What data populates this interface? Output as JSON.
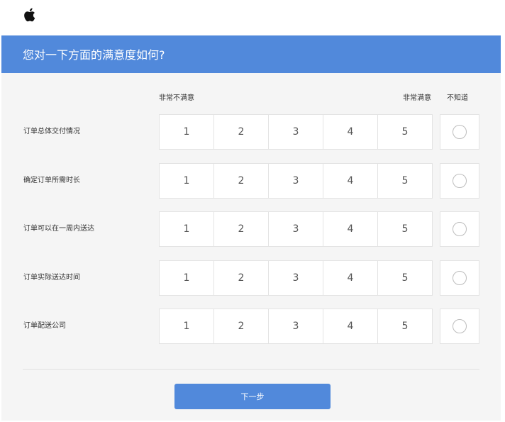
{
  "header": {
    "logo_icon": "apple-logo-icon",
    "question": "您对一下方面的满意度如何?"
  },
  "scale_labels": {
    "low": "非常不满意",
    "high": "非常满意",
    "dont_know": "不知道"
  },
  "rows": [
    {
      "label": "订单总体交付情况",
      "options": [
        "1",
        "2",
        "3",
        "4",
        "5"
      ]
    },
    {
      "label": "确定订单所需时长",
      "options": [
        "1",
        "2",
        "3",
        "4",
        "5"
      ]
    },
    {
      "label": "订单可以在一周内送达",
      "options": [
        "1",
        "2",
        "3",
        "4",
        "5"
      ]
    },
    {
      "label": "订单实际送达时间",
      "options": [
        "1",
        "2",
        "3",
        "4",
        "5"
      ]
    },
    {
      "label": "订单配送公司",
      "options": [
        "1",
        "2",
        "3",
        "4",
        "5"
      ]
    }
  ],
  "footer": {
    "next_label": "下一步"
  },
  "colors": {
    "accent": "#5189DB",
    "panel_bg": "#F5F5F5",
    "border": "#E3E3E3"
  }
}
